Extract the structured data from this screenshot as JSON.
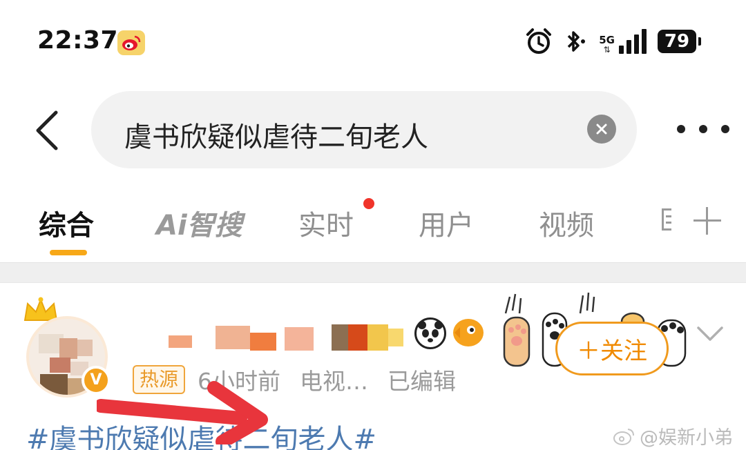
{
  "status_bar": {
    "time": "22:37",
    "network": "5G",
    "battery": "79",
    "icons": [
      "weibo-notification-icon",
      "alarm-icon",
      "bluetooth-icon",
      "signal-icon",
      "battery-icon"
    ]
  },
  "search": {
    "query": "虞书欣疑似虐待二旬老人"
  },
  "tabs": {
    "items": [
      "综合",
      "Ai智搜",
      "实时",
      "用户",
      "视频"
    ],
    "active": "综合",
    "accent_color": "#f7a818"
  },
  "post": {
    "follow_label": "＋关注",
    "hot_tag": "热源",
    "time_ago": "6小时前",
    "source": "电视…",
    "edited": "已编辑",
    "hashtag": "#虞书欣疑似虐待二旬老人#"
  },
  "watermark": {
    "text": "@娱新小弟"
  },
  "colors": {
    "hashtag": "#4d7ab0",
    "follow": "#f08a00",
    "annotation_arrow": "#e8353c",
    "red_dot": "#f0342a"
  }
}
